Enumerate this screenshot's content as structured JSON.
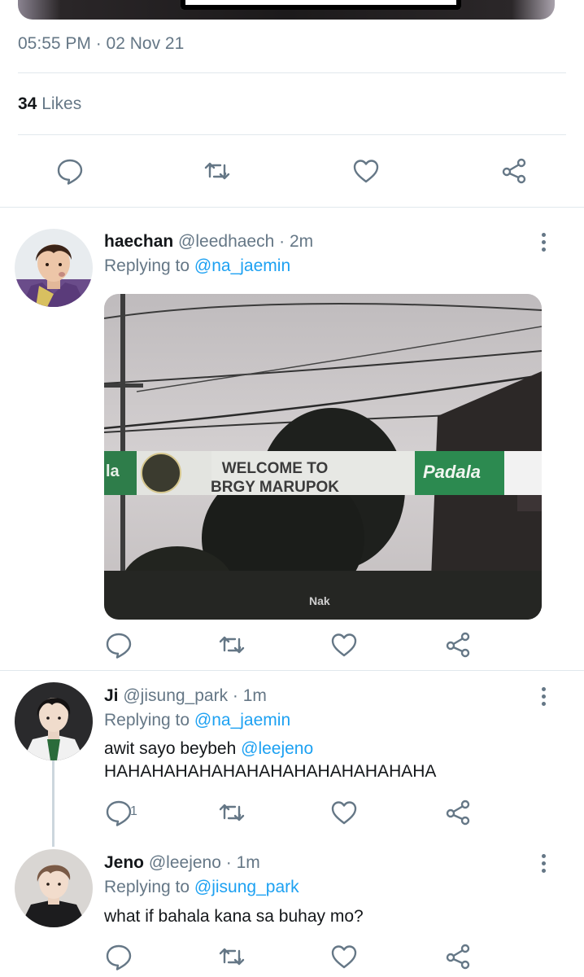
{
  "main_tweet": {
    "timestamp": "05:55 PM · 02 Nov 21",
    "likes_count": "34",
    "likes_label": "Likes"
  },
  "replies": [
    {
      "display_name": "haechan",
      "handle": "@leedhaech",
      "time": "· 2m",
      "replying_label": "Replying to",
      "replying_to": "@na_jaemin",
      "media": {
        "sign_text_line1": "WELCOME TO",
        "sign_text_line2": "BRGY MARUPOK",
        "left_text": "la",
        "right_text": "Padala",
        "watermark": "Nak"
      }
    },
    {
      "display_name": "Ji",
      "handle": "@jisung_park",
      "time": "· 1m",
      "replying_label": "Replying to",
      "replying_to": "@na_jaemin",
      "text_prefix": "awit sayo beybeh",
      "text_mention": "@leejeno",
      "text_line2": "HAHAHAHAHAHAHAHAHAHAHAHAHAHA",
      "reply_count": "1"
    },
    {
      "display_name": "Jeno",
      "handle": "@leejeno",
      "time": "· 1m",
      "replying_label": "Replying to",
      "replying_to": "@jisung_park",
      "text": "what if bahala kana sa buhay mo?"
    }
  ],
  "icons": {
    "reply": "reply-icon",
    "retweet": "retweet-icon",
    "like": "heart-icon",
    "share": "share-icon",
    "more": "more-icon"
  },
  "colors": {
    "accent": "#1da1f2",
    "secondary_text": "#657786",
    "divider": "#e1e8ed"
  }
}
